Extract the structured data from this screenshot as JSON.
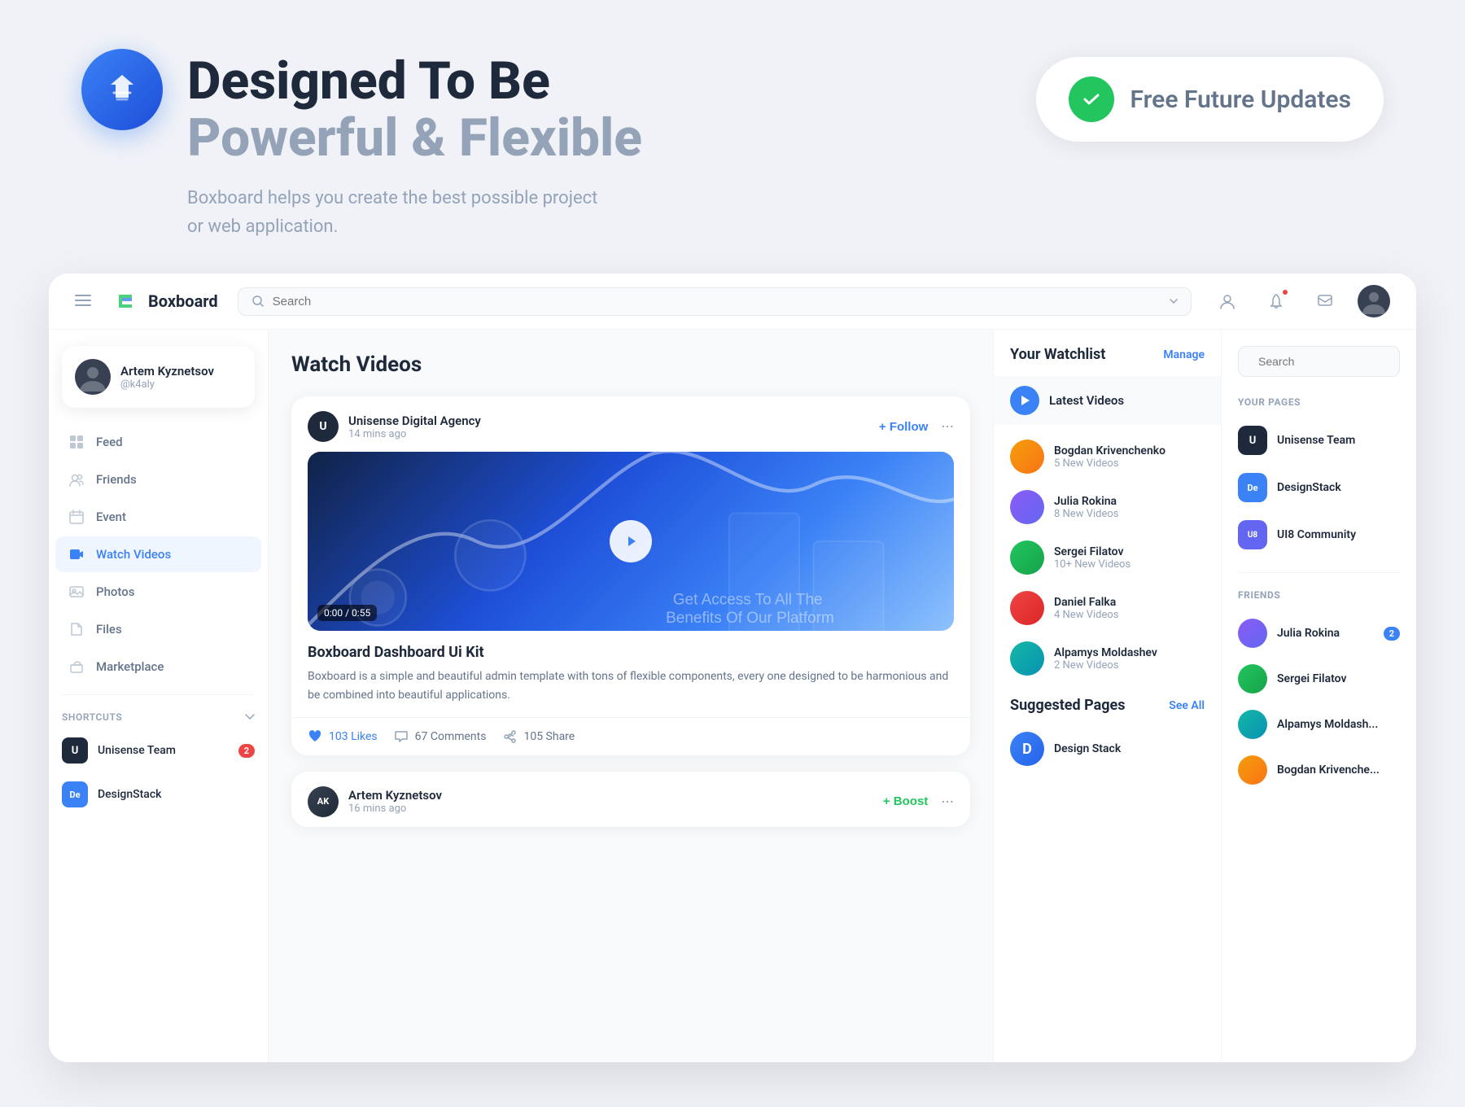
{
  "app": {
    "name": "Boxboard",
    "logo_letter": "B"
  },
  "hero": {
    "title_black": "Designed To Be",
    "title_colored": "Powerful & Flexible",
    "subtitle_line1": "Boxboard helps you create the best possible project",
    "subtitle_line2": "or web application.",
    "badge_text": "Free Future Updates",
    "badge_check": "✓"
  },
  "nav": {
    "search_placeholder": "Search",
    "page_title": "Watch Videos"
  },
  "sidebar": {
    "profile": {
      "name": "Artem Kyznetsov",
      "handle": "@k4aly"
    },
    "items": [
      {
        "label": "Feed",
        "icon": "feed"
      },
      {
        "label": "Friends",
        "icon": "friends"
      },
      {
        "label": "Event",
        "icon": "event"
      },
      {
        "label": "Watch Videos",
        "icon": "video",
        "active": true
      },
      {
        "label": "Photos",
        "icon": "photos"
      },
      {
        "label": "Files",
        "icon": "files"
      },
      {
        "label": "Marketplace",
        "icon": "marketplace"
      }
    ],
    "shortcuts_label": "SHORTCUTS",
    "shortcuts": [
      {
        "label": "Unisense Team",
        "abbr": "U",
        "color": "#1e293b",
        "badge": 2
      },
      {
        "label": "DesignStack",
        "abbr": "De",
        "color": "#3b82f6"
      }
    ]
  },
  "video_cards": [
    {
      "publisher": "Unisense Digital Agency",
      "publisher_abbr": "U",
      "time": "14 mins ago",
      "follow_label": "+ Follow",
      "title": "Boxboard Dashboard Ui Kit",
      "description": "Boxboard is a simple and beautiful admin template with tons of flexible components, every one designed to be harmonious and be combined into beautiful applications.",
      "duration": "0:00 / 0:55",
      "likes": "103 Likes",
      "comments": "67 Comments",
      "shares": "105 Share"
    },
    {
      "publisher": "Artem Kyznetsov",
      "publisher_abbr": "AK",
      "time": "16 mins ago",
      "boost_label": "+ Boost"
    }
  ],
  "watchlist": {
    "title": "Your Watchlist",
    "manage_label": "Manage",
    "latest_label": "Latest Videos",
    "items": [
      {
        "name": "Bogdan Krivenchenko",
        "count": "5 New Videos"
      },
      {
        "name": "Julia Rokina",
        "count": "8 New Videos"
      },
      {
        "name": "Sergei Filatov",
        "count": "10+ New Videos"
      },
      {
        "name": "Daniel Falka",
        "count": "4 New Videos"
      },
      {
        "name": "Alpamys Moldashev",
        "count": "2 New Videos"
      }
    ],
    "suggested_title": "Suggested Pages",
    "see_all_label": "See All",
    "suggested": [
      {
        "name": "Design Stack",
        "abbr": "D"
      }
    ]
  },
  "right_panel": {
    "search_placeholder": "Search",
    "your_pages_label": "YOUR PAGES",
    "pages": [
      {
        "name": "Unisense Team",
        "abbr": "U",
        "color": "#1e293b"
      },
      {
        "name": "DesignStack",
        "abbr": "De",
        "color": "#3b82f6"
      },
      {
        "name": "UI8 Community",
        "abbr": "U8",
        "color": "#6366f1"
      }
    ],
    "friends_label": "FRIENDS",
    "friends": [
      {
        "name": "Julia Rokina",
        "badge": 2
      },
      {
        "name": "Sergei Filatov"
      },
      {
        "name": "Alpamys Moldash..."
      },
      {
        "name": "Bogdan Krivenche..."
      }
    ]
  }
}
